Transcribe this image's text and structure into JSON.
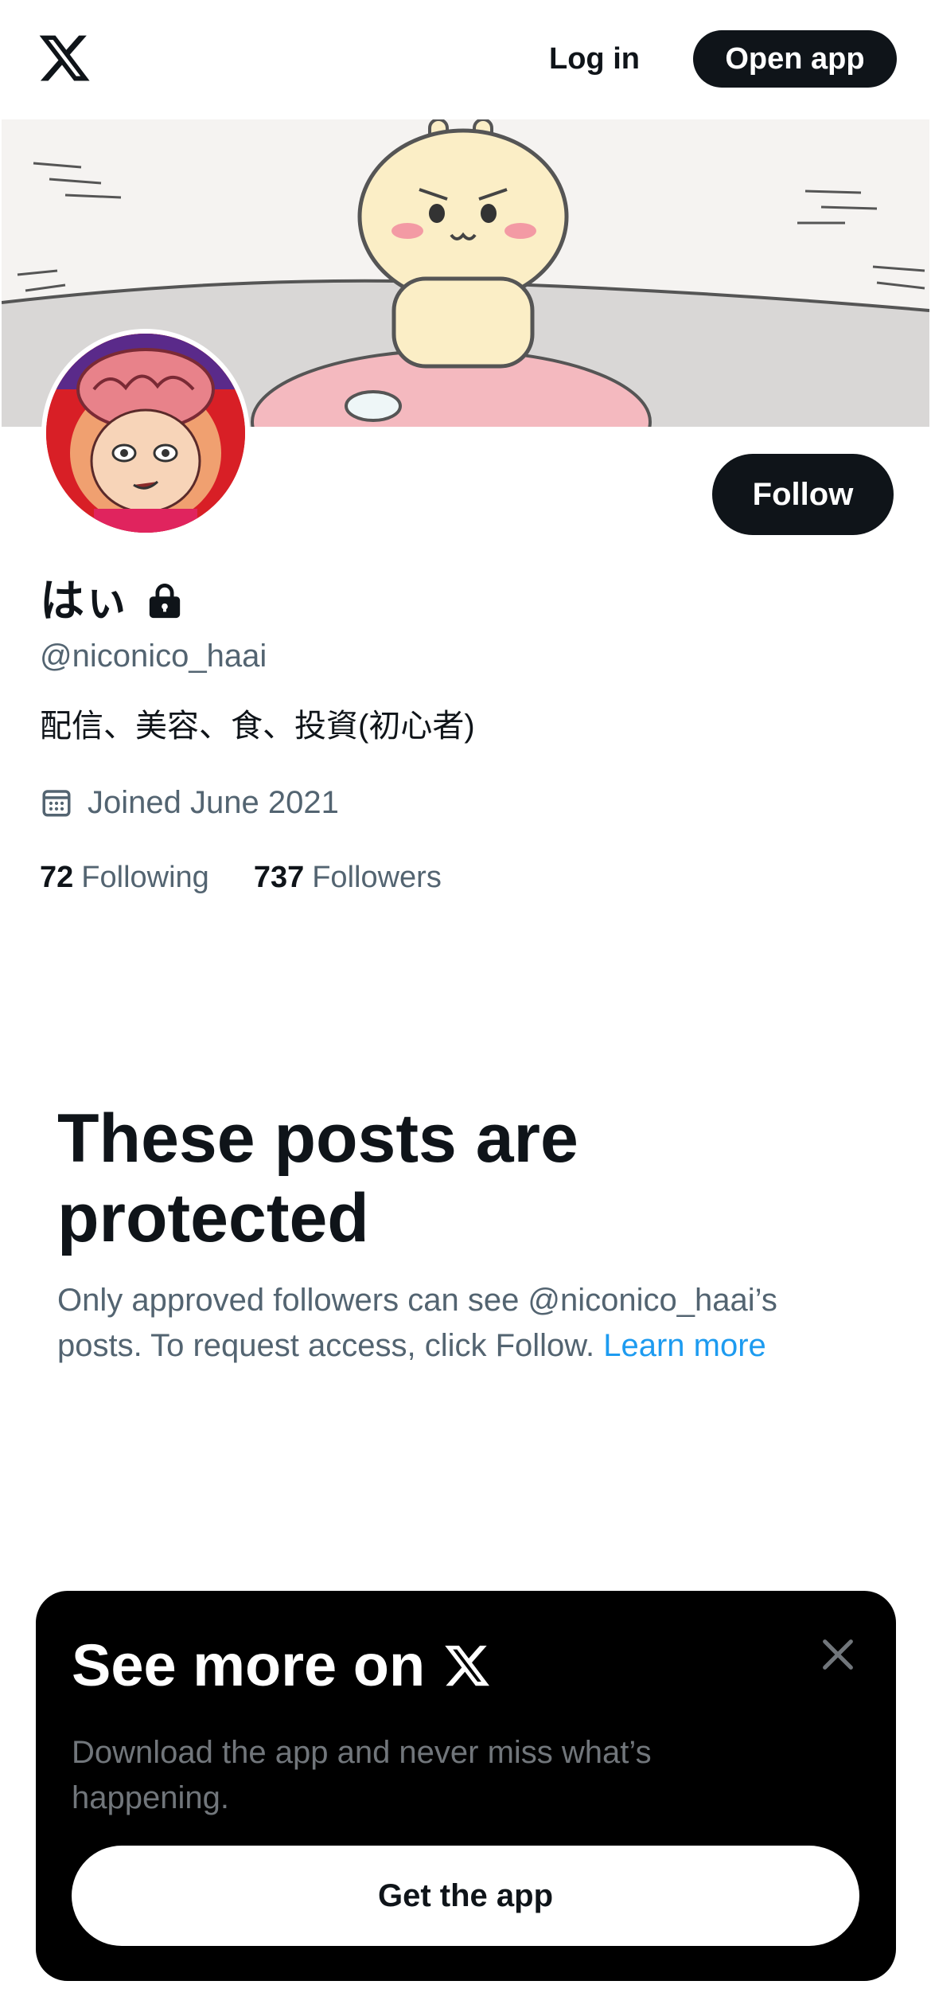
{
  "header": {
    "logo_icon": "x-logo-icon",
    "login_label": "Log in",
    "open_app_label": "Open app"
  },
  "profile": {
    "display_name": "はぃ",
    "handle": "@niconico_haai",
    "bio": "配信、美容、食、投資(初心者)",
    "joined": "Joined June 2021",
    "following_count": "72",
    "following_label": "Following",
    "followers_count": "737",
    "followers_label": "Followers",
    "follow_label": "Follow",
    "protected_icon": "lock-icon"
  },
  "protected": {
    "title": "These posts are protected",
    "description": "Only approved followers can see @niconico_haai’s posts. To request access, click Follow.",
    "learn_more": "Learn more"
  },
  "promo": {
    "title": "See more on",
    "description": "Download the app and never miss what’s happening.",
    "button_label": "Get the app",
    "close_icon": "close-icon"
  },
  "colors": {
    "text_primary": "#0f1419",
    "text_secondary": "#536471",
    "link": "#1d9bf0",
    "promo_bg": "#000000",
    "promo_text_secondary": "#71767b"
  }
}
